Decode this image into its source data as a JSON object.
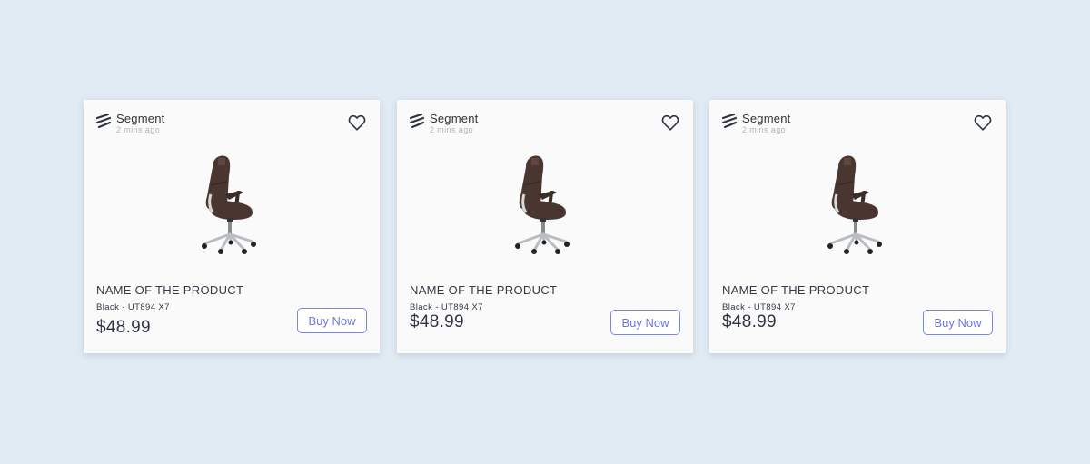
{
  "colors": {
    "background": "#e1ebf4",
    "card": "#fafafa",
    "accent": "#6d77e3",
    "text": "#333a44",
    "muted": "#b0b5ba"
  },
  "cards": [
    {
      "brand": "Segment",
      "posted": "2 mins ago",
      "name": "NAME OF THE PRODUCT",
      "variant": "Black - UT894 X7",
      "price": "$48.99",
      "buy_label": "Buy Now",
      "favorite_icon": "heart-outline-icon",
      "logo_icon": "segment-logo-icon"
    },
    {
      "brand": "Segment",
      "posted": "2 mins ago",
      "name": "NAME OF THE PRODUCT",
      "variant": "Black - UT894 X7",
      "price": "$48.99",
      "buy_label": "Buy Now",
      "favorite_icon": "heart-outline-icon",
      "logo_icon": "segment-logo-icon"
    },
    {
      "brand": "Segment",
      "posted": "2 mins ago",
      "name": "NAME OF THE PRODUCT",
      "variant": "Black - UT894 X7",
      "price": "$48.99",
      "buy_label": "Buy Now",
      "favorite_icon": "heart-outline-icon",
      "logo_icon": "segment-logo-icon"
    }
  ]
}
